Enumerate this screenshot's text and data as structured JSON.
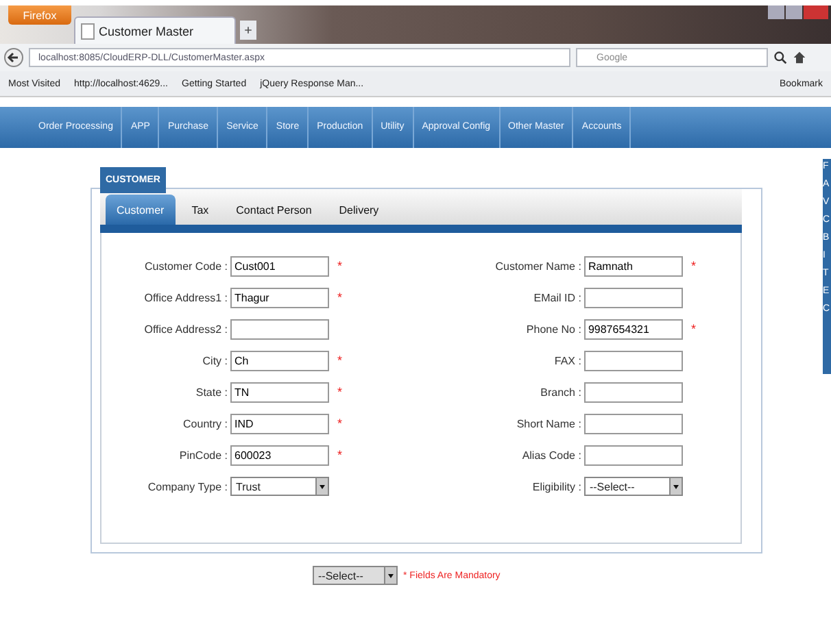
{
  "browser": {
    "menu_button": "Firefox",
    "tab_title": "Customer Master",
    "url": "localhost:8085/CloudERP-DLL/CustomerMaster.aspx",
    "search_placeholder": "Google",
    "bookmarks": [
      "Most Visited",
      "http://localhost:4629...",
      "Getting Started",
      "jQuery Response Man..."
    ],
    "bookmarks_menu": "Bookmark"
  },
  "nav": [
    "Order Processing",
    "APP",
    "Purchase",
    "Service",
    "Store",
    "Production",
    "Utility",
    "Approval Config",
    "Other Master",
    "Accounts"
  ],
  "side_panel_letters": [
    "F",
    "A",
    "V",
    "C",
    "B",
    "I",
    "T",
    "E",
    "C"
  ],
  "section_title": "CUSTOMER",
  "tabs": [
    {
      "label": "Customer",
      "selected": true
    },
    {
      "label": "Tax",
      "selected": false
    },
    {
      "label": "Contact Person",
      "selected": false
    },
    {
      "label": "Delivery",
      "selected": false
    }
  ],
  "left_fields": [
    {
      "kind": "text",
      "label": "Customer Code :",
      "value": "Cust001",
      "required_mark": "*"
    },
    {
      "kind": "text",
      "label": "Office Address1 :",
      "value": "Thagur",
      "required_mark": "*"
    },
    {
      "kind": "text",
      "label": "Office Address2 :"
    },
    {
      "kind": "text",
      "label": "City :",
      "value": "Ch",
      "required_mark": "*"
    },
    {
      "kind": "text",
      "label": "State :",
      "value": "TN",
      "required_mark": "*"
    },
    {
      "kind": "text",
      "label": "Country :",
      "value": "IND",
      "required_mark": "*"
    },
    {
      "kind": "text",
      "label": "PinCode :",
      "value": "600023",
      "required_mark": "*"
    },
    {
      "kind": "select",
      "label": "Company Type :",
      "value": "Trust"
    }
  ],
  "right_fields": [
    {
      "kind": "text",
      "label": "Customer Name :",
      "value": "Ramnath",
      "required_mark": "*"
    },
    {
      "kind": "text",
      "label": "EMail ID :"
    },
    {
      "kind": "text",
      "label": "Phone No :",
      "value": "9987654321",
      "required_mark": "*"
    },
    {
      "kind": "text",
      "label": "FAX :"
    },
    {
      "kind": "text",
      "label": "Branch :"
    },
    {
      "kind": "text",
      "label": "Short Name :"
    },
    {
      "kind": "text",
      "label": "Alias Code :"
    },
    {
      "kind": "select",
      "label": "Eligibility :",
      "value": "--Select--"
    }
  ],
  "footer": {
    "select_value": "--Select--",
    "mandatory_note": "* Fields Are Mandatory"
  }
}
